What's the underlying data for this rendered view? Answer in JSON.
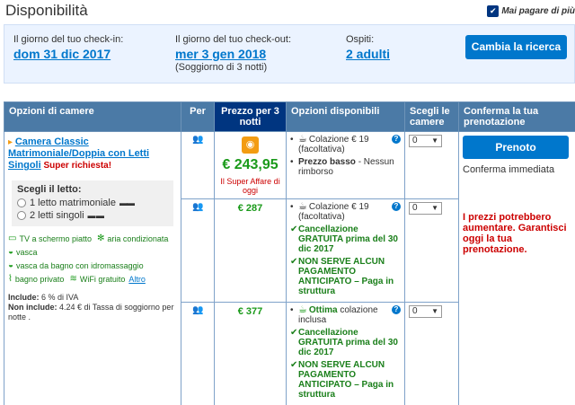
{
  "header": {
    "title": "Disponibilità",
    "mai_pagare": "Mai pagare di più"
  },
  "search": {
    "checkin_label": "Il giorno del tuo check-in:",
    "checkin_value": "dom 31 dic 2017",
    "checkout_label": "Il giorno del tuo check-out:",
    "checkout_value": "mer 3 gen 2018",
    "stay_note": "(Soggiorno di 3 notti)",
    "guests_label": "Ospiti:",
    "guests_value": "2 adulti",
    "change_button": "Cambia la ricerca"
  },
  "table": {
    "headers": {
      "room": "Opzioni di camere",
      "per": "Per",
      "price": "Prezzo per 3 notti",
      "options": "Opzioni disponibili",
      "choose": "Scegli le camere",
      "confirm": "Conferma la tua prenotazione"
    }
  },
  "room": {
    "name": "Camera Classic Matrimoniale/Doppia con Letti Singoli",
    "super_tag": "Super richiesta!",
    "bed_title": "Scegli il letto:",
    "bed_option_1": "1 letto matrimoniale",
    "bed_option_2": "2 letti singoli",
    "facilities": {
      "tv": "TV a schermo piatto",
      "ac": "aria condizionata",
      "bath": "vasca",
      "jacuzzi": "vasca da bagno con idromassaggio",
      "private_bath": "bagno privato",
      "wifi": "WiFi gratuito",
      "more": "Altro"
    },
    "includes_label": "Include:",
    "includes_text": "6 % di IVA",
    "not_includes_label": "Non include:",
    "not_includes_text": "4.24 € di Tassa di soggiorno per notte ."
  },
  "rates": [
    {
      "price": "€ 243,95",
      "deal": "Il Super Affare di oggi",
      "breakfast": "Colazione € 19",
      "breakfast_note": "(facoltativa)",
      "low_price_bold": "Prezzo basso",
      "low_price_rest": "- Nessun rimborso",
      "qty": "0"
    },
    {
      "price": "€ 287",
      "breakfast": "Colazione € 19",
      "breakfast_note": "(facoltativa)",
      "cancel": "Cancellazione GRATUITA prima del 30 dic 2017",
      "no_prepay": "NON SERVE ALCUN PAGAMENTO ANTICIPATO – Paga in struttura",
      "qty": "0"
    },
    {
      "price": "€ 377",
      "breakfast_bold": "Ottima",
      "breakfast": "colazione inclusa",
      "cancel": "Cancellazione GRATUITA prima del 30 dic 2017",
      "no_prepay": "NON SERVE ALCUN PAGAMENTO ANTICIPATO – Paga in struttura",
      "qty": "0"
    }
  ],
  "booking": {
    "button": "Prenoto",
    "confirm_note": "Conferma immediata",
    "warning": "I prezzi potrebbero aumentare. Garantisci oggi la tua prenotazione."
  },
  "icons": {
    "people": "two-people-icon",
    "breakfast": "coffee-cup-icon",
    "check": "green-check-icon",
    "help": "question-icon"
  },
  "colors": {
    "brand_blue": "#0077cc",
    "dark_blue": "#003580",
    "header_blue": "#4b7aa6",
    "price_green": "#1a9a1a",
    "alert_red": "#cc0000",
    "deal_orange": "#f39c12"
  }
}
